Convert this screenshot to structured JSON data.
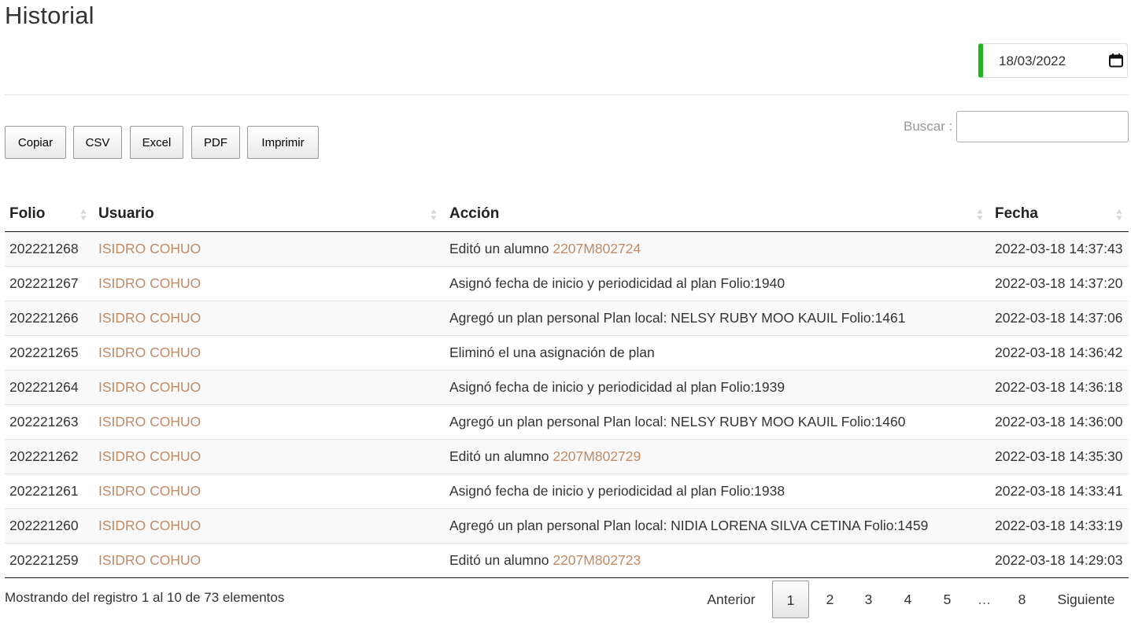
{
  "page": {
    "title": "Historial"
  },
  "date_filter": {
    "value": "18/03/2022"
  },
  "export_buttons": [
    "Copiar",
    "CSV",
    "Excel",
    "PDF",
    "Imprimir"
  ],
  "search": {
    "label": "Buscar :",
    "value": ""
  },
  "table": {
    "headers": [
      "Folio",
      "Usuario",
      "Acción",
      "Fecha"
    ],
    "rows": [
      {
        "folio": "202221268",
        "usuario": "ISIDRO COHUO",
        "accion": "Editó un alumno ",
        "accion_link": "2207M802724",
        "fecha": "2022-03-18 14:37:43"
      },
      {
        "folio": "202221267",
        "usuario": "ISIDRO COHUO",
        "accion": "Asignó fecha de inicio y periodicidad al plan Folio:1940",
        "accion_link": "",
        "fecha": "2022-03-18 14:37:20"
      },
      {
        "folio": "202221266",
        "usuario": "ISIDRO COHUO",
        "accion": "Agregó un plan personal Plan local: NELSY RUBY MOO KAUIL Folio:1461",
        "accion_link": "",
        "fecha": "2022-03-18 14:37:06"
      },
      {
        "folio": "202221265",
        "usuario": "ISIDRO COHUO",
        "accion": "Eliminó el una asignación de plan",
        "accion_link": "",
        "fecha": "2022-03-18 14:36:42"
      },
      {
        "folio": "202221264",
        "usuario": "ISIDRO COHUO",
        "accion": "Asignó fecha de inicio y periodicidad al plan Folio:1939",
        "accion_link": "",
        "fecha": "2022-03-18 14:36:18"
      },
      {
        "folio": "202221263",
        "usuario": "ISIDRO COHUO",
        "accion": "Agregó un plan personal Plan local: NELSY RUBY MOO KAUIL Folio:1460",
        "accion_link": "",
        "fecha": "2022-03-18 14:36:00"
      },
      {
        "folio": "202221262",
        "usuario": "ISIDRO COHUO",
        "accion": "Editó un alumno ",
        "accion_link": "2207M802729",
        "fecha": "2022-03-18 14:35:30"
      },
      {
        "folio": "202221261",
        "usuario": "ISIDRO COHUO",
        "accion": "Asignó fecha de inicio y periodicidad al plan Folio:1938",
        "accion_link": "",
        "fecha": "2022-03-18 14:33:41"
      },
      {
        "folio": "202221260",
        "usuario": "ISIDRO COHUO",
        "accion": "Agregó un plan personal Plan local: NIDIA LORENA SILVA CETINA Folio:1459",
        "accion_link": "",
        "fecha": "2022-03-18 14:33:19"
      },
      {
        "folio": "202221259",
        "usuario": "ISIDRO COHUO",
        "accion": "Editó un alumno ",
        "accion_link": "2207M802723",
        "fecha": "2022-03-18 14:29:03"
      }
    ]
  },
  "info": "Mostrando del registro 1 al 10 de 73 elementos",
  "pagination": {
    "previous": "Anterior",
    "pages": [
      "1",
      "2",
      "3",
      "4",
      "5",
      "…",
      "8"
    ],
    "current": "1",
    "next": "Siguiente"
  },
  "colors": {
    "accent_green": "#21b521",
    "link": "#c08a64"
  }
}
